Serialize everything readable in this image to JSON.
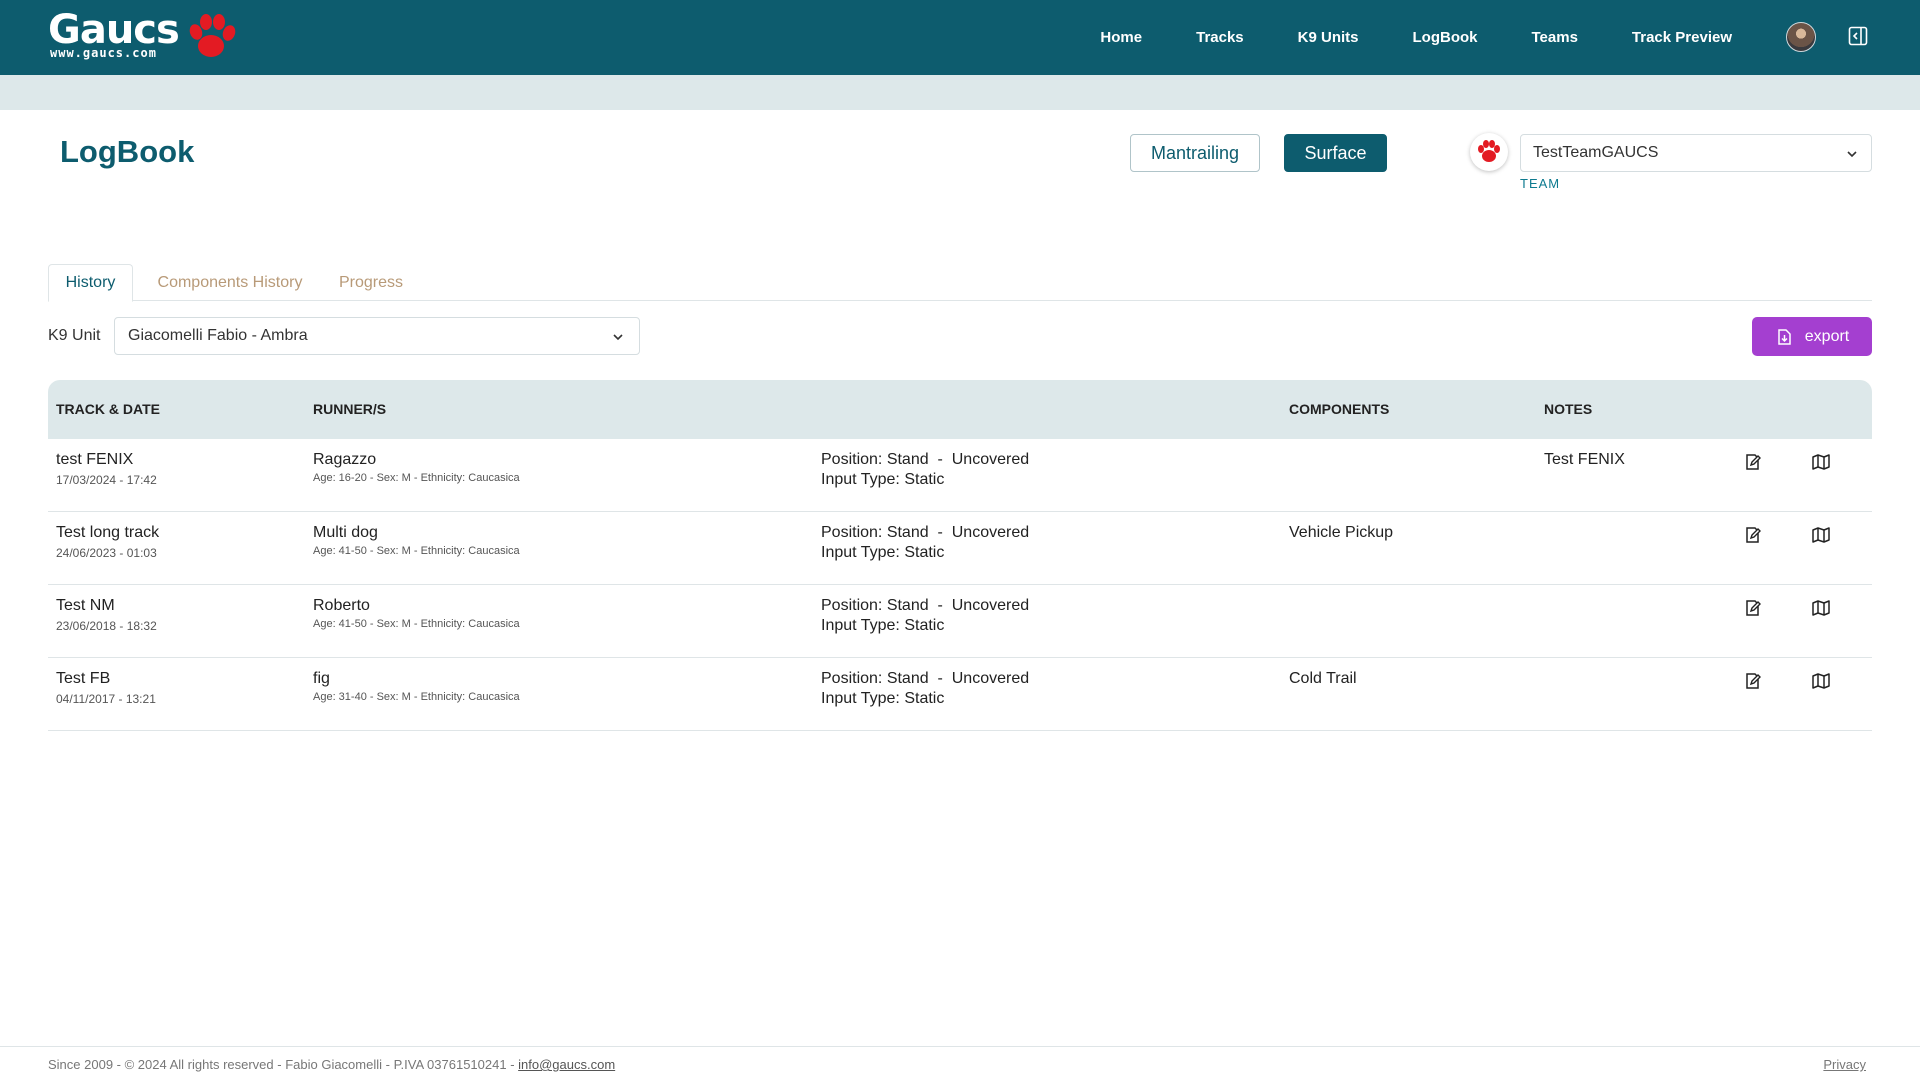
{
  "brand": {
    "logo_text": "Gaucs",
    "logo_sub": "www.gaucs.com"
  },
  "nav": {
    "items": [
      "Home",
      "Tracks",
      "K9 Units",
      "LogBook",
      "Teams",
      "Track Preview"
    ]
  },
  "page": {
    "title": "LogBook"
  },
  "modes": {
    "mantrailing": "Mantrailing",
    "surface": "Surface",
    "active": "Surface"
  },
  "team": {
    "selected": "TestTeamGAUCS",
    "label": "TEAM"
  },
  "tabs": {
    "history": "History",
    "components_history": "Components History",
    "progress": "Progress",
    "active": "History"
  },
  "filter": {
    "k9_label": "K9 Unit",
    "k9_selected": "Giacomelli Fabio - Ambra"
  },
  "export": {
    "label": "export"
  },
  "table": {
    "headers": {
      "track_date": "TRACK & DATE",
      "runners": "RUNNER/S",
      "components": "COMPONENTS",
      "notes": "NOTES"
    },
    "rows": [
      {
        "name": "test FENIX",
        "date": "17/03/2024 - 17:42",
        "runner": "Ragazzo",
        "runner_meta": "Age: 16-20 - Sex: M - Ethnicity: Caucasica",
        "position": "Position: Stand  -  Uncovered",
        "input_type": "Input Type: Static",
        "components": "",
        "notes": "Test FENIX"
      },
      {
        "name": "Test long track",
        "date": "24/06/2023 - 01:03",
        "runner": "Multi dog",
        "runner_meta": "Age: 41-50 - Sex: M - Ethnicity: Caucasica",
        "position": "Position: Stand  -  Uncovered",
        "input_type": "Input Type: Static",
        "components": "Vehicle Pickup",
        "notes": ""
      },
      {
        "name": "Test NM",
        "date": "23/06/2018 - 18:32",
        "runner": "Roberto",
        "runner_meta": "Age: 41-50 - Sex: M - Ethnicity: Caucasica",
        "position": "Position: Stand  -  Uncovered",
        "input_type": "Input Type: Static",
        "components": "",
        "notes": ""
      },
      {
        "name": "Test FB",
        "date": "04/11/2017 - 13:21",
        "runner": "fig",
        "runner_meta": "Age: 31-40 - Sex: M - Ethnicity: Caucasica",
        "position": "Position: Stand  -  Uncovered",
        "input_type": "Input Type: Static",
        "components": "Cold Trail",
        "notes": ""
      }
    ]
  },
  "footer": {
    "text": "Since 2009 - © 2024 All rights reserved - Fabio Giacomelli - P.IVA 03761510241 - ",
    "email": "info@gaucs.com",
    "privacy": "Privacy"
  },
  "icons": {
    "edit": "edit-icon",
    "map": "map-icon",
    "export": "file-export-icon",
    "chevron": "chevron-down-icon",
    "panel": "panel-toggle-icon",
    "paw": "paw-icon"
  },
  "colors": {
    "primary": "#0d5c6e",
    "accent": "#a43fd0",
    "paw": "#e31b23",
    "subbar": "#dde8ea"
  }
}
